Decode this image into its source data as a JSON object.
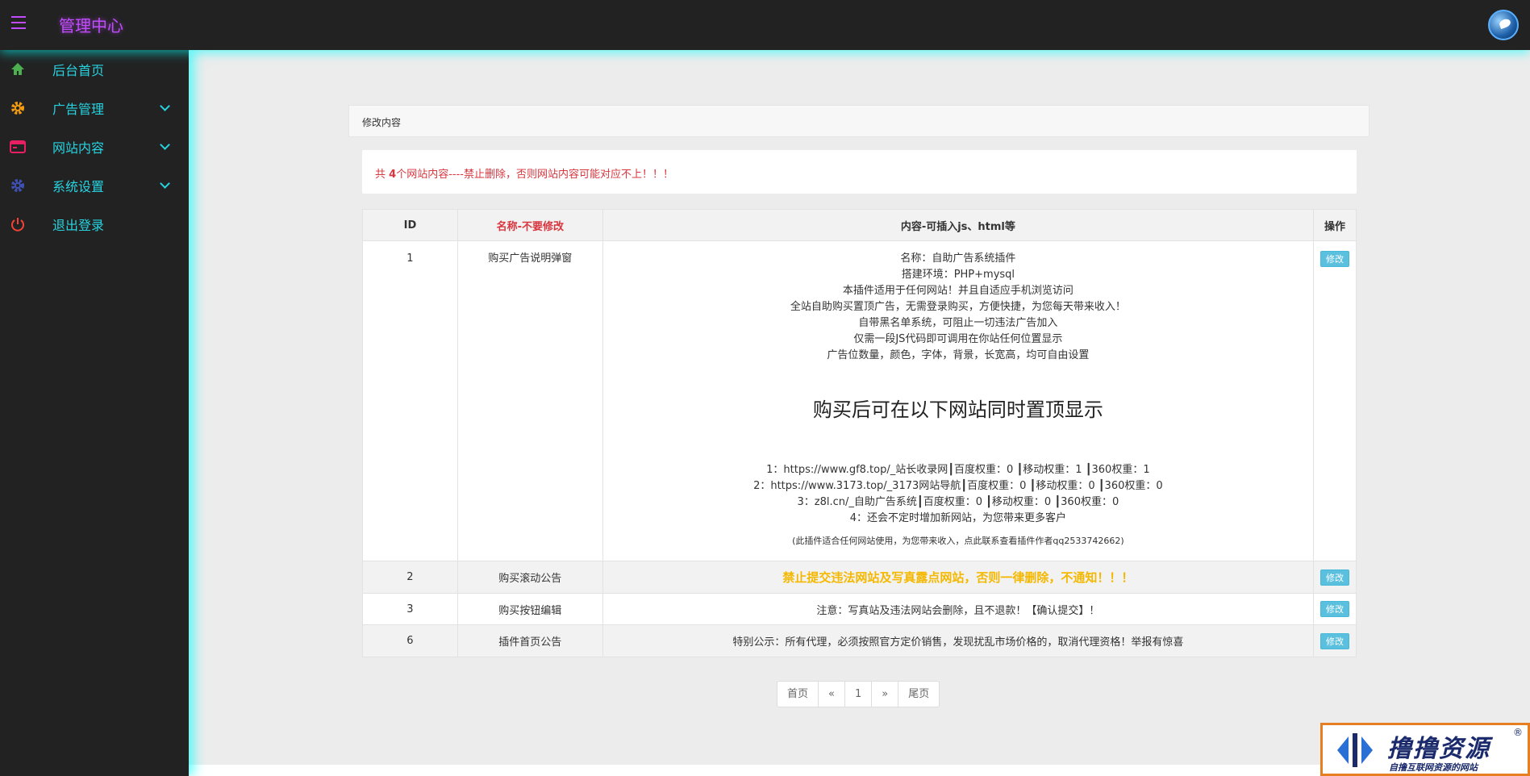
{
  "header": {
    "title": "管理中心",
    "menu_icon": "hamburger-icon",
    "avatar_icon": "bird-logo-icon"
  },
  "sidebar": {
    "items": [
      {
        "label": "后台首页",
        "icon": "home-icon",
        "icon_color": "#4caf50",
        "has_submenu": false
      },
      {
        "label": "广告管理",
        "icon": "gear-icon",
        "icon_color": "#f39c12",
        "has_submenu": true
      },
      {
        "label": "网站内容",
        "icon": "window-icon",
        "icon_color": "#e91e63",
        "has_submenu": true
      },
      {
        "label": "系统设置",
        "icon": "gear-icon",
        "icon_color": "#3f51b5",
        "has_submenu": true
      },
      {
        "label": "退出登录",
        "icon": "power-icon",
        "icon_color": "#f44336",
        "has_submenu": false
      }
    ]
  },
  "panel": {
    "title": "修改内容"
  },
  "notice": {
    "prefix": "共 ",
    "count": "4",
    "suffix": "个网站内容----禁止删除，否则网站内容可能对应不上！！！"
  },
  "table": {
    "headers": [
      "ID",
      "名称-不要修改",
      "内容-可插入js、html等",
      "操作"
    ],
    "edit_label": "修改",
    "rows": [
      {
        "id": "1",
        "name": "购买广告说明弹窗",
        "lines": [
          "名称：自助广告系统插件",
          "搭建环境：PHP+mysql",
          "本插件适用于任何网站！并且自适应手机浏览访问",
          "全站自助购买置顶广告，无需登录购买，方便快捷，为您每天带来收入！",
          "自带黑名单系统，可阻止一切违法广告加入",
          "仅需一段JS代码即可调用在你站任何位置显示",
          "广告位数量，颜色，字体，背景，长宽高，均可自由设置"
        ],
        "heading": "购买后可在以下网站同时置顶显示",
        "sites": [
          "1：https://www.gf8.top/_站长收录网┃百度权重：0 ┃移动权重：1 ┃360权重：1",
          "2：https://www.3173.top/_3173网站导航┃百度权重：0 ┃移动权重：0 ┃360权重：0",
          "3：z8l.cn/_自助广告系统┃百度权重：0 ┃移动权重：0 ┃360权重：0",
          "4：还会不定时增加新网站，为您带来更多客户"
        ],
        "footnote": "(此插件适合任何网站使用，为您带来收入，点此联系查看插件作者qq2533742662)"
      },
      {
        "id": "2",
        "name": "购买滚动公告",
        "content": "禁止提交违法网站及写真露点网站，否则一律删除，不通知！！！"
      },
      {
        "id": "3",
        "name": "购买按钮编辑",
        "content": "注意：写真站及违法网站会删除，且不退款！【确认提交】！"
      },
      {
        "id": "6",
        "name": "插件首页公告",
        "content": "特别公示：所有代理，必须按照官方定价销售，发现扰乱市场价格的，取消代理资格！举报有惊喜"
      }
    ]
  },
  "pager": {
    "first": "首页",
    "prev": "«",
    "page": "1",
    "next": "»",
    "last": "尾页"
  },
  "watermark": {
    "title": "撸撸资源",
    "reg": "®",
    "sub": "自撸互联网资源的网站"
  },
  "colors": {
    "accent": "#c24bff",
    "sidebar_text": "#27d3e0",
    "danger": "#d9363e",
    "warning": "#f5b800",
    "button": "#5bc0de"
  }
}
